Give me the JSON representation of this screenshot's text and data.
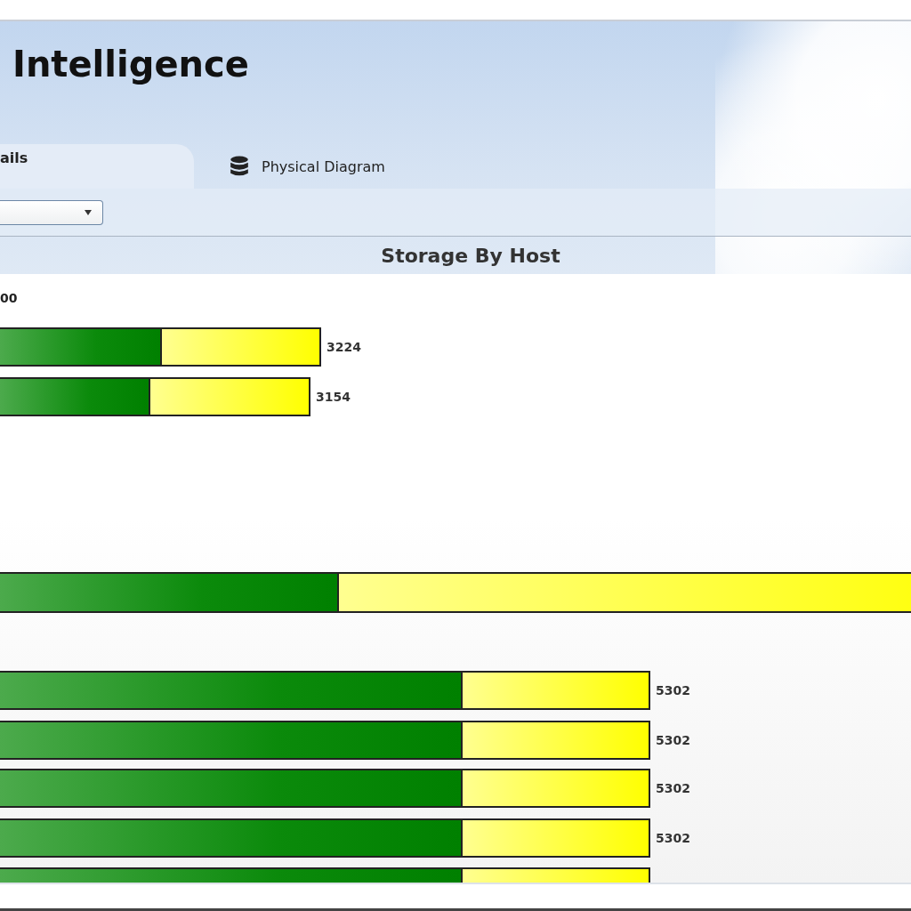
{
  "header": {
    "title": "Intelligence"
  },
  "tabs": [
    {
      "label": "ails",
      "selected": true,
      "kind": "text"
    },
    {
      "label": "Physical Diagram",
      "selected": false,
      "kind": "database"
    }
  ],
  "chart": {
    "title": "Storage By Host",
    "axis_label": "00",
    "bars": [
      {
        "level": 0.5,
        "reading": "3224"
      },
      {
        "level": 0.48,
        "reading": "3154"
      },
      {
        "level": 0.34
      },
      {
        "level": 0.71,
        "reading": "5302"
      },
      {
        "level": 0.71,
        "reading": "5302"
      },
      {
        "level": 0.71,
        "reading": "5302"
      },
      {
        "level": 0.71,
        "reading": "5302"
      },
      {
        "level": 0.71
      }
    ]
  }
}
